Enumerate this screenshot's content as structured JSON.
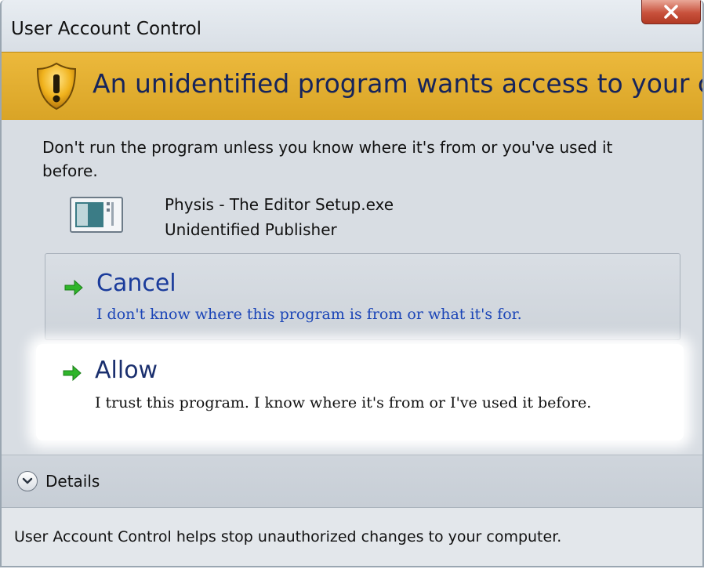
{
  "window": {
    "title": "User Account Control",
    "close_label": "Close"
  },
  "banner": {
    "icon": "shield-warning-icon",
    "title": "An unidentified program wants access to your computer",
    "color": "#e3ae2f"
  },
  "content": {
    "warning": "Don't run the program unless you know where it's from or you've used it before.",
    "program": {
      "icon": "program-window-icon",
      "name": "Physis - The Editor Setup.exe",
      "publisher": "Unidentified Publisher"
    }
  },
  "options": {
    "cancel": {
      "icon": "green-arrow-icon",
      "title": "Cancel",
      "subtitle": "I don't know where this program is from or what it's for."
    },
    "allow": {
      "icon": "green-arrow-icon",
      "title": "Allow",
      "subtitle": "I trust this program. I know where it's from or I've used it before."
    }
  },
  "details": {
    "icon": "chevron-down-circle-icon",
    "label": "Details"
  },
  "footer": {
    "text": "User Account Control helps stop unauthorized changes to your computer."
  },
  "colors": {
    "link_blue": "#1b45b7",
    "arrow_green": "#2fb52a",
    "banner_gold": "#e3ae2f"
  }
}
